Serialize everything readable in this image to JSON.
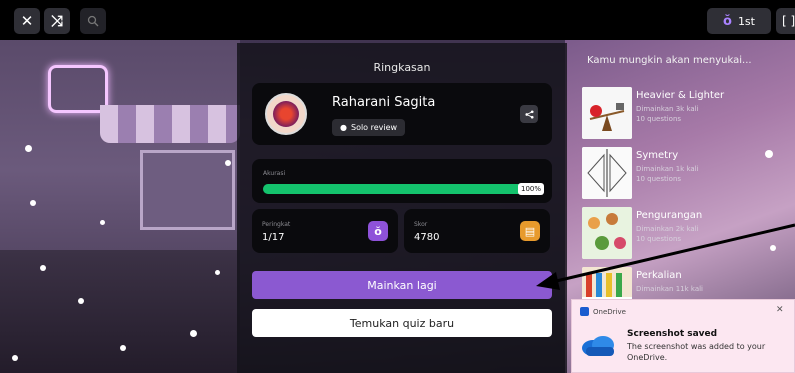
{
  "topbar": {
    "close_icon": "close-icon",
    "shuffle_icon": "shuffle-icon",
    "zoom_icon": "zoom-icon",
    "rank_badge": "1st",
    "fullscreen_icon": "fullscreen-icon"
  },
  "summary": {
    "title": "Ringkasan",
    "player_name": "Raharani Sagita",
    "mode": "Solo review",
    "accuracy_label": "Akurasi",
    "accuracy_value": 100,
    "accuracy_text": "100%",
    "rank_label": "Peringkat",
    "rank_value": "1/17",
    "score_label": "Skor",
    "score_value": "4780",
    "play_again": "Mainkan lagi",
    "find_quiz": "Temukan quiz baru",
    "accent": "#8b59d1",
    "accuracy_color": "#14c36d"
  },
  "recommendations": {
    "title": "Kamu mungkin akan menyukai...",
    "items": [
      {
        "name": "Heavier & Lighter",
        "played": "Dimainkan 3k kali",
        "questions": "10 questions"
      },
      {
        "name": "Symetry",
        "played": "Dimainkan 1k kali",
        "questions": "10 questions"
      },
      {
        "name": "Pengurangan",
        "played": "Dimainkan 2k kali",
        "questions": "10 questions"
      },
      {
        "name": "Perkalian",
        "played": "Dimainkan 11k kali",
        "questions": ""
      }
    ]
  },
  "toast": {
    "app": "OneDrive",
    "title": "Screenshot saved",
    "body": "The screenshot was added to your OneDrive.",
    "close": "✕"
  }
}
